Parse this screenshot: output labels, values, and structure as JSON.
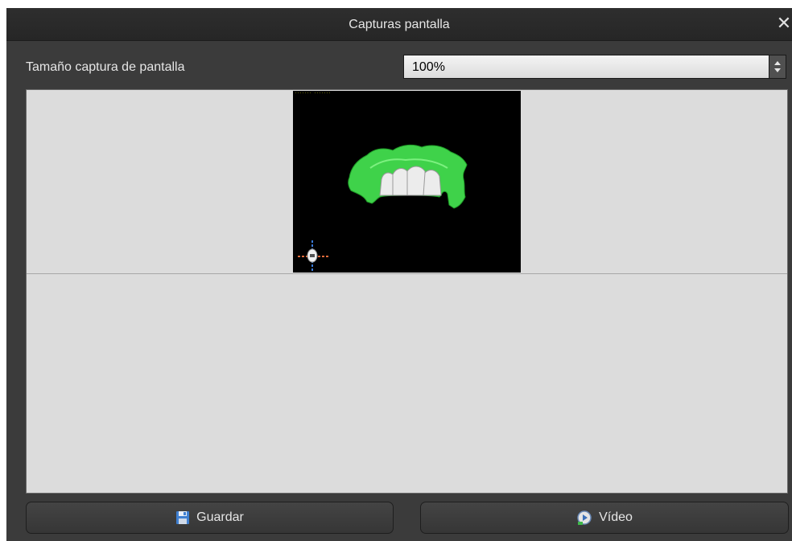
{
  "window": {
    "title": "Capturas pantalla"
  },
  "settings": {
    "size_label": "Tamaño captura de pantalla",
    "size_value": "100%"
  },
  "buttons": {
    "save_label": "Guardar",
    "video_label": "Vídeo"
  },
  "icons": {
    "close": "close-icon",
    "save": "floppy-disk-icon",
    "video": "play-video-icon"
  },
  "colors": {
    "model_green": "#3fd24a",
    "teeth": "#ececec"
  }
}
